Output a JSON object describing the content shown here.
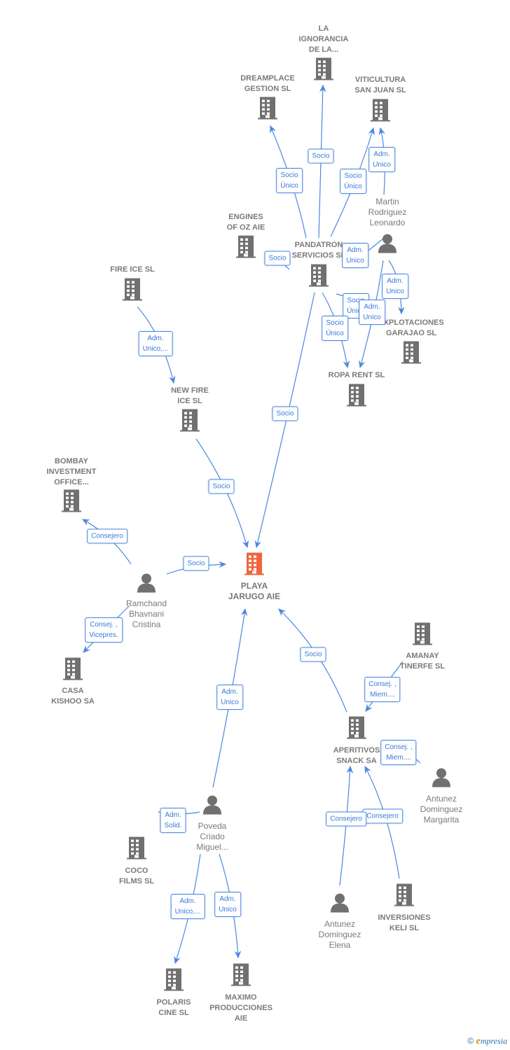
{
  "colors": {
    "edge": "#4a88e0",
    "icon": "#707070",
    "main_node": "#f0643c",
    "label_text": "#7a7a7a"
  },
  "nodes": [
    {
      "id": "la_ignorancia",
      "type": "company",
      "label": [
        "LA",
        "IGNORANCIA",
        "DE LA..."
      ]
    },
    {
      "id": "dreamplace",
      "type": "company",
      "label": [
        "DREAMPLACE",
        "GESTION  SL"
      ]
    },
    {
      "id": "viticultura",
      "type": "company",
      "label": [
        "VITICULTURA",
        "SAN JUAN  SL"
      ]
    },
    {
      "id": "engines",
      "type": "company",
      "label": [
        "ENGINES",
        "OF OZ  AIE"
      ]
    },
    {
      "id": "pandatron",
      "type": "company",
      "label": [
        "PANDATRON",
        "SERVICIOS SL"
      ]
    },
    {
      "id": "martin",
      "type": "person",
      "label": [
        "Martin",
        "Rodriguez",
        "Leonardo"
      ]
    },
    {
      "id": "explotaciones",
      "type": "company",
      "label": [
        "EXPLOTACIONES",
        "GARAJAO SL"
      ]
    },
    {
      "id": "ropa_rent",
      "type": "company",
      "label": [
        "ROPA RENT  SL"
      ]
    },
    {
      "id": "fire_ice",
      "type": "company",
      "label": [
        "FIRE ICE SL"
      ]
    },
    {
      "id": "new_fire_ice",
      "type": "company",
      "label": [
        "NEW FIRE",
        "ICE  SL"
      ]
    },
    {
      "id": "bombay",
      "type": "company",
      "label": [
        "BOMBAY",
        "INVESTMENT",
        "OFFICE..."
      ]
    },
    {
      "id": "playa",
      "type": "company",
      "main": true,
      "label": [
        "PLAYA",
        "JARUGO AIE"
      ]
    },
    {
      "id": "ramchand",
      "type": "person",
      "label": [
        "Ramchand",
        "Bhavnani",
        "Cristina"
      ]
    },
    {
      "id": "casa_kishoo",
      "type": "company",
      "label": [
        "CASA",
        "KISHOO SA"
      ]
    },
    {
      "id": "amanay",
      "type": "company",
      "label": [
        "AMANAY",
        "TINERFE SL"
      ]
    },
    {
      "id": "aperitivos",
      "type": "company",
      "label": [
        "APERITIVOS",
        "SNACK SA"
      ]
    },
    {
      "id": "antunez_margarita",
      "type": "person",
      "label": [
        "Antunez",
        "Dominguez",
        "Margarita"
      ]
    },
    {
      "id": "poveda",
      "type": "person",
      "label": [
        "Poveda",
        "Criado",
        "Miguel..."
      ]
    },
    {
      "id": "coco_films",
      "type": "company",
      "label": [
        "COCO",
        "FILMS  SL"
      ]
    },
    {
      "id": "antunez_elena",
      "type": "person",
      "label": [
        "Antunez",
        "Dominguez",
        "Elena"
      ]
    },
    {
      "id": "inversiones_keli",
      "type": "company",
      "label": [
        "INVERSIONES",
        "KELI SL"
      ]
    },
    {
      "id": "polaris",
      "type": "company",
      "label": [
        "POLARIS",
        "CINE  SL"
      ]
    },
    {
      "id": "maximo",
      "type": "company",
      "label": [
        "MAXIMO",
        "PRODUCCIONES",
        "AIE"
      ]
    }
  ],
  "edges": [
    {
      "from": "pandatron",
      "to": "la_ignorancia",
      "label": [
        "Socio"
      ]
    },
    {
      "from": "pandatron",
      "to": "dreamplace",
      "label": [
        "Socio",
        "Único"
      ]
    },
    {
      "from": "pandatron",
      "to": "viticultura",
      "label": [
        "Socio",
        "Único"
      ]
    },
    {
      "from": "martin",
      "to": "viticultura",
      "label": [
        "Adm.",
        "Unico"
      ]
    },
    {
      "from": "pandatron",
      "to": "engines",
      "label": [
        "Socio"
      ]
    },
    {
      "from": "martin",
      "to": "pandatron",
      "label": [
        "Adm.",
        "Unico"
      ]
    },
    {
      "from": "martin",
      "to": "explotaciones",
      "label": [
        "Adm.",
        "Unico"
      ]
    },
    {
      "from": "pandatron",
      "to": "explotaciones",
      "label": [
        "Socio",
        "Único"
      ]
    },
    {
      "from": "martin",
      "to": "ropa_rent",
      "label": [
        "Adm.",
        "Unico"
      ]
    },
    {
      "from": "pandatron",
      "to": "ropa_rent",
      "label": [
        "Socio",
        "Único"
      ]
    },
    {
      "from": "pandatron",
      "to": "playa",
      "label": [
        "Socio"
      ]
    },
    {
      "from": "fire_ice",
      "to": "new_fire_ice",
      "label": [
        "Adm.",
        "Unico,..."
      ]
    },
    {
      "from": "new_fire_ice",
      "to": "playa",
      "label": [
        "Socio"
      ]
    },
    {
      "from": "ramchand",
      "to": "bombay",
      "label": [
        "Consejero"
      ]
    },
    {
      "from": "ramchand",
      "to": "playa",
      "label": [
        "Socio"
      ]
    },
    {
      "from": "ramchand",
      "to": "casa_kishoo",
      "label": [
        "Consej. ,",
        "Vicepres."
      ]
    },
    {
      "from": "aperitivos",
      "to": "playa",
      "label": [
        "Socio"
      ]
    },
    {
      "from": "amanay",
      "to": "aperitivos",
      "label": [
        "Consej. ,",
        "Miem...."
      ]
    },
    {
      "from": "antunez_margarita",
      "to": "aperitivos",
      "label": [
        "Consej. ,",
        "Miem...."
      ]
    },
    {
      "from": "inversiones_keli",
      "to": "aperitivos",
      "label": [
        "Consejero"
      ]
    },
    {
      "from": "antunez_elena",
      "to": "aperitivos",
      "label": [
        "Consejero"
      ]
    },
    {
      "from": "poveda",
      "to": "playa",
      "label": [
        "Adm.",
        "Unico"
      ]
    },
    {
      "from": "poveda",
      "to": "coco_films",
      "label": [
        "Adm.",
        "Solid."
      ]
    },
    {
      "from": "poveda",
      "to": "polaris",
      "label": [
        "Adm.",
        "Unico,..."
      ]
    },
    {
      "from": "poveda",
      "to": "maximo",
      "label": [
        "Adm.",
        "Unico"
      ]
    }
  ],
  "footer": {
    "copyright": "©",
    "brand_initial": "e",
    "brand_rest": "mpresia"
  }
}
